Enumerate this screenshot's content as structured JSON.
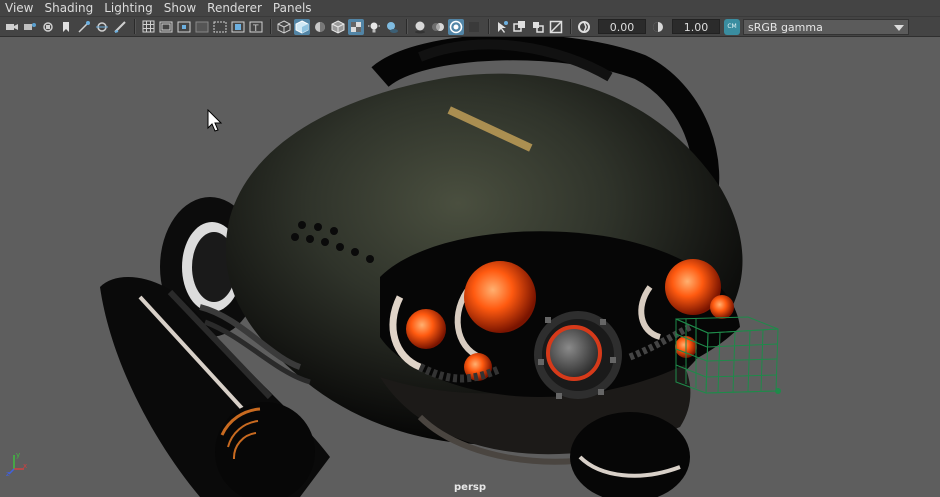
{
  "menubar": {
    "items": [
      {
        "label": "View"
      },
      {
        "label": "Shading"
      },
      {
        "label": "Lighting"
      },
      {
        "label": "Show"
      },
      {
        "label": "Renderer"
      },
      {
        "label": "Panels"
      }
    ]
  },
  "toolbar": {
    "exposure_value": "0.00",
    "gamma_value": "1.00",
    "color_management_badge": "CM",
    "color_space": "sRGB gamma"
  },
  "viewport": {
    "camera_label": "persp",
    "axis_labels": {
      "y": "y",
      "x": "x",
      "z": "z"
    }
  },
  "colors": {
    "menubar_bg": "#444444",
    "viewport_bg": "#5e5e5e",
    "active_button": "#5285a6",
    "glow": "#ff6a1a"
  }
}
